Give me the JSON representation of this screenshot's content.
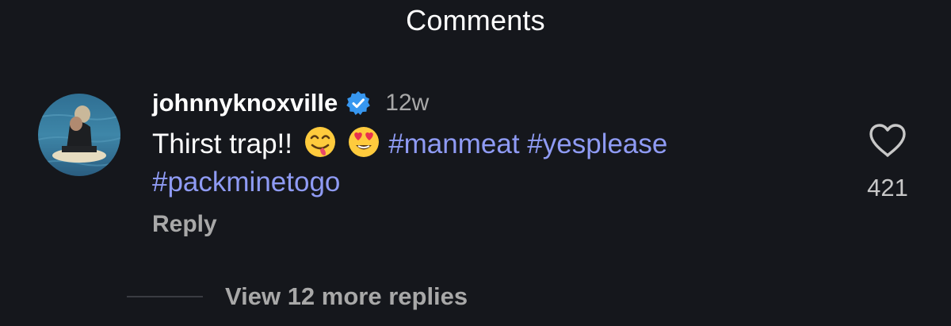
{
  "header": {
    "title": "Comments"
  },
  "comment": {
    "username": "johnnyknoxville",
    "verified_icon": "verified-badge-icon",
    "timestamp": "12w",
    "text_prefix": "Thirst trap!!",
    "emoji_1": "savoring-food-face-emoji",
    "emoji_2": "heart-eyes-emoji",
    "hashtags": [
      "#manmeat",
      "#yesplease",
      "#packminetogo"
    ],
    "reply_label": "Reply",
    "like_icon": "heart-outline-icon",
    "like_count": "421"
  },
  "replies": {
    "view_label": "View 12 more replies"
  },
  "colors": {
    "background": "#15171c",
    "hashtag": "#8f9bf4",
    "verified": "#3797f0",
    "muted": "#a8a8a8"
  }
}
